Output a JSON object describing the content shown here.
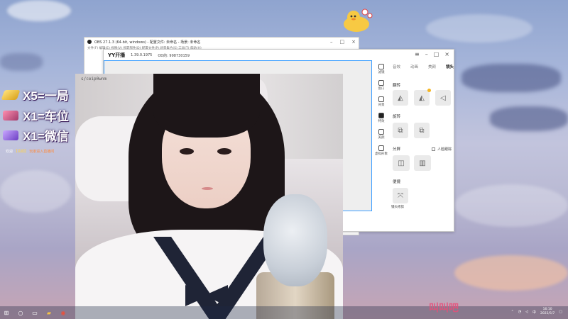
{
  "promo": {
    "line1": "X5=一局",
    "line2": "X1=车位",
    "line3": "X1=微信"
  },
  "chat": {
    "prefix": "欢迎",
    "nick": "【青铜】",
    "msg": "玩家进入直播间"
  },
  "obs": {
    "title": "OBS 27.1.3 (64-bit, windows) - 配置文件: 未命名 - 场景: 未命名",
    "menu": "文件(F)  编辑(E)  视图(V)  停靠部件(D)  配置文件(P)  场景集合(S)  工具(T)  帮助(H)"
  },
  "yy": {
    "brand": "YY开播",
    "version": "1.39.0.1975",
    "uid": "OD的: 998730159",
    "tabs": [
      "音效",
      "动画",
      "美颜",
      "镜头"
    ],
    "active_tab": "镜头",
    "side_nav": [
      "滤镜",
      "窗口",
      "背景",
      "特效",
      "美颜",
      "虚拟形象"
    ],
    "section_flip": "翻转",
    "section_rotate": "旋转",
    "section_split": "分屏",
    "checkbox_label": "人脸跟踪",
    "section_other": "便捷",
    "other_btn_label": "镜头修剪"
  },
  "camera": {
    "caption": "s/ceip0wnm"
  },
  "taskbar": {
    "time": "16:10",
    "date": "2022/5/7",
    "lang": "中"
  },
  "watermark": "叫叫吧"
}
